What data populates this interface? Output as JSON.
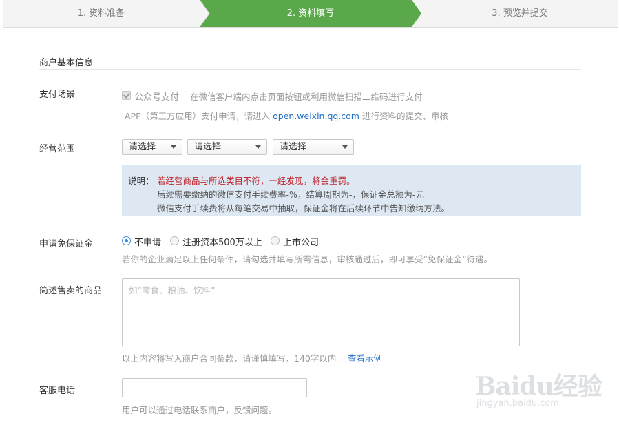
{
  "steps": [
    {
      "label": "1. 资料准备"
    },
    {
      "label": "2. 资料填写"
    },
    {
      "label": "3. 预览并提交"
    }
  ],
  "colors": {
    "active_step": "#5aa84a",
    "link": "#2270c9",
    "warning": "#c0262e",
    "notice_bg": "#dde8f3"
  },
  "section": {
    "title": "商户基本信息"
  },
  "payment_scene": {
    "label": "支付场景",
    "checkbox_label": "公众号支付",
    "checkbox_hint": "在微信客户端内点击页面按钮或利用微信扫描二维码进行支付",
    "app_prefix": "APP（第三方应用）支付申请，请进入",
    "app_link": "open.weixin.qq.com",
    "app_suffix": "进行资料的提交、审核"
  },
  "business_scope": {
    "label": "经营范围",
    "selects": [
      {
        "value": "请选择"
      },
      {
        "value": "请选择"
      },
      {
        "value": "请选择"
      }
    ]
  },
  "notice": {
    "prefix": "说明：",
    "warning": "若经营商品与所选类目不符，一经发现，将会重罚。",
    "line2": "后续需要缴纳的微信支付手续费率-%，结算周期为-，保证金总额为-元",
    "line3": "微信支付手续费将从每笔交易中抽取，保证金将在后续环节中告知缴纳方法。"
  },
  "deposit_exemption": {
    "label": "申请免保证金",
    "options": [
      {
        "label": "不申请",
        "selected": true
      },
      {
        "label": "注册资本500万以上",
        "selected": false
      },
      {
        "label": "上市公司",
        "selected": false
      }
    ],
    "hint": "若你的企业满足以上任何条件，请勾选并填写所需信息，审核通过后，即可享受“免保证金”待遇。"
  },
  "goods": {
    "label": "简述售卖的商品",
    "placeholder": "如“零食、粮油、饮料”",
    "hint": "以上内容将写入商户合同条款，请谨慎填写，140字以内。",
    "example_link": "查看示例"
  },
  "phone": {
    "label": "客服电话",
    "value": "",
    "hint": "用户可以通过电话联系商户，反馈问题。"
  },
  "watermark": {
    "brand": "Baidu经验",
    "url": "jingyan.baidu.com"
  }
}
